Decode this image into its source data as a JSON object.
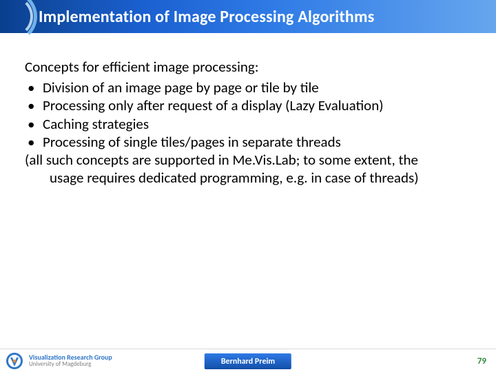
{
  "header": {
    "title": "Implementation of Image Processing Algorithms"
  },
  "body": {
    "lead": "Concepts for efficient image processing:",
    "bullets": [
      "Division of an image page by page or tile by tile",
      "Processing only after request of a display (Lazy Evaluation)",
      "Caching strategies",
      "Processing of single tiles/pages in separate threads"
    ],
    "note_line1": "(all such concepts are supported in Me.Vis.Lab; to some extent, the",
    "note_line2": "usage requires dedicated programming, e.g. in case of threads)"
  },
  "footer": {
    "logo_line1": "Visualization Research Group",
    "logo_line2": "University of Magdeburg",
    "author": "Bernhard Preim",
    "page": "79"
  }
}
